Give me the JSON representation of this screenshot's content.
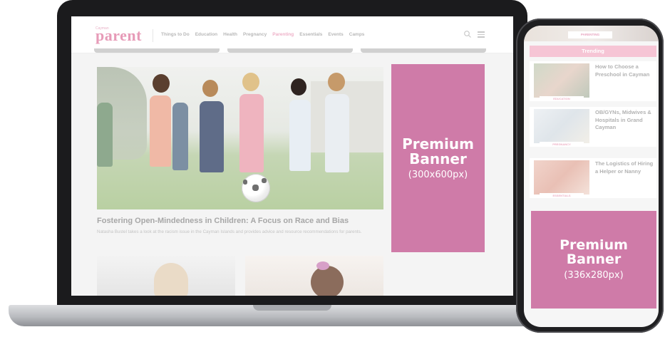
{
  "desktop": {
    "site": {
      "logo_small": "Cayman",
      "logo": "parent",
      "nav": [
        "Things to Do",
        "Education",
        "Health",
        "Pregnancy",
        "Parenting",
        "Essentials",
        "Events",
        "Camps"
      ],
      "active_nav": "Parenting"
    },
    "article": {
      "title": "Fostering Open-Mindedness in Children: A Focus on Race and Bias",
      "description": "Natasha Bustel takes a look at the racism issue in the Cayman Islands and provides advice and resource recommendations for parents."
    },
    "banner": {
      "title_line1": "Premium",
      "title_line2": "Banner",
      "size": "(300x600px)"
    }
  },
  "mobile": {
    "top_tag": "PARENTING",
    "trending_label": "Trending",
    "items": [
      {
        "tag": "EDUCATION",
        "title": "How to Choose a Preschool in Cayman"
      },
      {
        "tag": "PREGNANCY",
        "title": "OB/GYNs, Midwives & Hospitals in Grand Cayman"
      },
      {
        "tag": "ESSENTIALS",
        "title": "The Logistics of Hiring a Helper or Nanny"
      }
    ],
    "banner": {
      "title_line1": "Premium",
      "title_line2": "Banner",
      "size": "(336x280px)"
    }
  },
  "colors": {
    "banner": "#cf7ba8",
    "brand_pink": "#e79bb8",
    "trending_bg": "#f6c5d5",
    "device_frame": "#1b1b1d"
  }
}
